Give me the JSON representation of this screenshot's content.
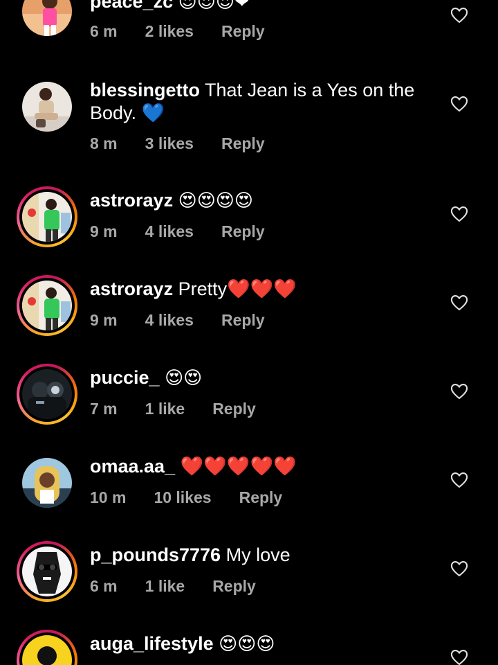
{
  "comments": [
    {
      "username": "peace_zc",
      "body": "😍😍😍❤",
      "time": "6 m",
      "likes": "2 likes",
      "reply": "Reply",
      "avatar": "woman-pink-outfit"
    },
    {
      "username": "blessingetto",
      "body": "That Jean is a Yes on the Body. 💙",
      "time": "8 m",
      "likes": "3 likes",
      "reply": "Reply",
      "avatar": "woman-sitting-beige"
    },
    {
      "username": "astrorayz",
      "body": "😍😍😍😍",
      "time": "9 m",
      "likes": "4 likes",
      "reply": "Reply",
      "avatar": "man-green-shirt"
    },
    {
      "username": "astrorayz",
      "body": "Pretty❤️❤️❤️",
      "time": "9 m",
      "likes": "4 likes",
      "reply": "Reply",
      "avatar": "man-green-shirt"
    },
    {
      "username": "puccie_",
      "body": "😍😍",
      "time": "7 m",
      "likes": "1 like",
      "reply": "Reply",
      "avatar": "person-dark-hood"
    },
    {
      "username": "omaa.aa_",
      "body": "❤️❤️❤️❤️❤️",
      "time": "10 m",
      "likes": "10 likes",
      "reply": "Reply",
      "avatar": "woman-blonde-braids"
    },
    {
      "username": "p_pounds7776",
      "body": "My love",
      "time": "6 m",
      "likes": "1 like",
      "reply": "Reply",
      "avatar": "man-sunglasses-bw"
    },
    {
      "username": "auga_lifestyle",
      "body": "😍😍😍",
      "time": "",
      "likes": "",
      "reply": "",
      "avatar": "silhouette-yellow"
    }
  ],
  "icons": {
    "like": "heart-outline-icon"
  },
  "colors": {
    "background": "#000000",
    "text": "#ffffff",
    "meta": "#a8a8a8"
  }
}
